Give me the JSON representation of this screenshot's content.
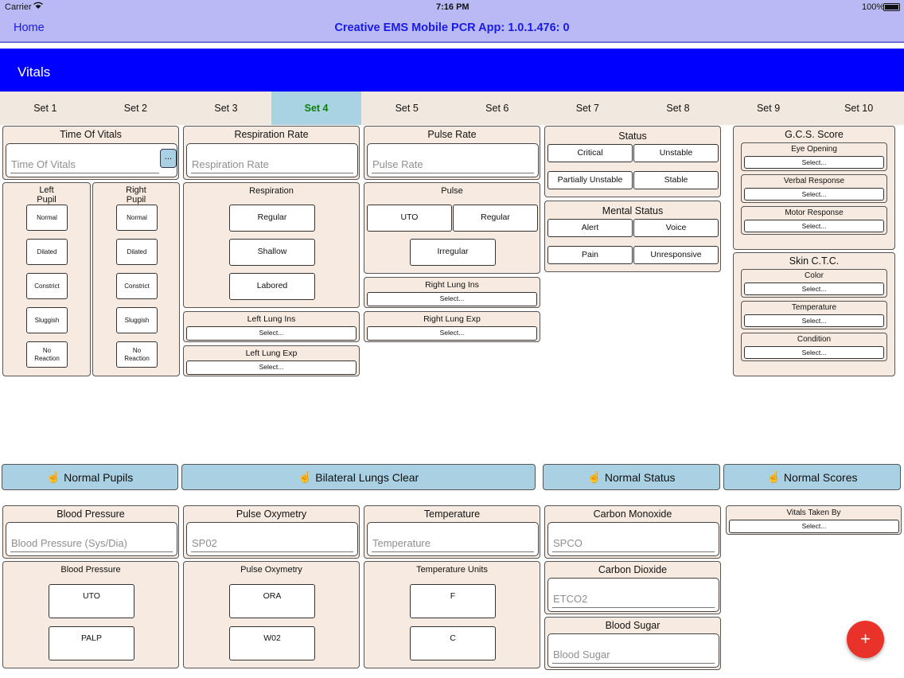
{
  "status_bar": {
    "carrier": "Carrier",
    "time": "7:16 PM",
    "battery": "100%"
  },
  "nav": {
    "back": "Home",
    "title": "Creative EMS Mobile PCR App: 1.0.1.476: 0"
  },
  "section": {
    "title": "Vitals"
  },
  "tabs": [
    "Set 1",
    "Set 2",
    "Set 3",
    "Set 4",
    "Set 5",
    "Set 6",
    "Set 7",
    "Set 8",
    "Set 9",
    "Set 10"
  ],
  "active_tab": "Set 4",
  "time_of_vitals": {
    "title": "Time Of Vitals",
    "placeholder": "Time Of Vitals",
    "more": "..."
  },
  "left_pupil": {
    "title": "Left\nPupil",
    "options": [
      "Normal",
      "Dilated",
      "Constrict",
      "Sluggish",
      "No\nReaction"
    ]
  },
  "right_pupil": {
    "title": "Right\nPupil",
    "options": [
      "Normal",
      "Dilated",
      "Constrict",
      "Sluggish",
      "No\nReaction"
    ]
  },
  "resp_rate": {
    "title": "Respiration Rate",
    "placeholder": "Respiration Rate"
  },
  "respiration": {
    "title": "Respiration",
    "options": [
      "Regular",
      "Shallow",
      "Labored"
    ]
  },
  "left_lung_ins": {
    "title": "Left Lung Ins",
    "value": "Select..."
  },
  "left_lung_exp": {
    "title": "Left Lung Exp",
    "value": "Select..."
  },
  "pulse_rate": {
    "title": "Pulse Rate",
    "placeholder": "Pulse Rate"
  },
  "pulse": {
    "title": "Pulse",
    "options": [
      "UTO",
      "Regular",
      "Irregular"
    ]
  },
  "right_lung_ins": {
    "title": "Right Lung Ins",
    "value": "Select..."
  },
  "right_lung_exp": {
    "title": "Right Lung Exp",
    "value": "Select..."
  },
  "status": {
    "title": "Status",
    "options": [
      "Critical",
      "Unstable",
      "Partially Unstable",
      "Stable"
    ]
  },
  "mental_status": {
    "title": "Mental Status",
    "options": [
      "Alert",
      "Voice",
      "Pain",
      "Unresponsive"
    ]
  },
  "gcs": {
    "title": "G.C.S. Score",
    "items": [
      {
        "label": "Eye Opening",
        "value": "Select..."
      },
      {
        "label": "Verbal Response",
        "value": "Select..."
      },
      {
        "label": "Motor Response",
        "value": "Select..."
      }
    ]
  },
  "skin": {
    "title": "Skin C.T.C.",
    "items": [
      {
        "label": "Color",
        "value": "Select..."
      },
      {
        "label": "Temperature",
        "value": "Select..."
      },
      {
        "label": "Condition",
        "value": "Select..."
      }
    ]
  },
  "quick_buttons": [
    "Normal Pupils",
    "Bilateral Lungs Clear",
    "Normal Status",
    "Normal Scores"
  ],
  "blood_pressure": {
    "title": "Blood Pressure",
    "placeholder": "Blood Pressure (Sys/Dia)"
  },
  "bp_method": {
    "title": "Blood Pressure",
    "options": [
      "UTO",
      "PALP"
    ]
  },
  "pulse_ox": {
    "title": "Pulse Oxymetry",
    "placeholder": "SP02"
  },
  "pulse_ox_method": {
    "title": "Pulse Oxymetry",
    "options": [
      "ORA",
      "W02"
    ]
  },
  "temperature": {
    "title": "Temperature",
    "placeholder": "Temperature"
  },
  "temp_units": {
    "title": "Temperature Units",
    "options": [
      "F",
      "C"
    ]
  },
  "carbon_monoxide": {
    "title": "Carbon Monoxide",
    "placeholder": "SPCO"
  },
  "carbon_dioxide": {
    "title": "Carbon Dioxide",
    "placeholder": "ETCO2"
  },
  "blood_sugar": {
    "title": "Blood Sugar",
    "placeholder": "Blood Sugar"
  },
  "vitals_taken_by": {
    "title": "Vitals Taken By",
    "value": "Select..."
  },
  "fab": {
    "label": "+"
  },
  "colors": {
    "nav_bg": "#b9b9f5",
    "header_bg": "#0000ff",
    "panel_bg": "#f7ebe1",
    "active_tab_bg": "#a9d2e3",
    "quick_btn_bg": "#a9d0e3",
    "fab_bg": "#e8322a"
  }
}
